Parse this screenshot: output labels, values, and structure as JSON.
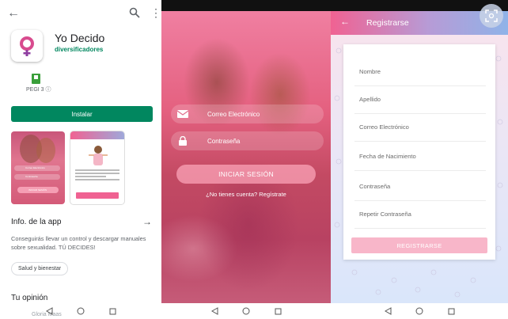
{
  "store": {
    "app_title": "Yo Decido",
    "developer": "diversificadores",
    "rating_label": "PEGI 3",
    "install_label": "Instalar",
    "screenshot1_lines": [
      "Correo Electrónico",
      "Contraseña",
      "INICIAR SESIÓN"
    ],
    "screenshot2_header": "Inicio",
    "screenshot2_button": "VER",
    "info_title": "Info. de la app",
    "description": "Conseguirás llevar un control y descargar manuales sobre sexualidad. TÚ DECIDES!",
    "category_chip": "Salud y bienestar",
    "opinion_title": "Tu opinión",
    "cut_text": "Gloria Maas"
  },
  "login": {
    "email_label": "Correo Electrónico",
    "password_label": "Contraseña",
    "login_button": "INICIAR SESIÓN",
    "register_link": "¿No tienes cuenta? Regístrate"
  },
  "register": {
    "title": "Registrarse",
    "fields": [
      "Nombre",
      "Apellido",
      "Correo Electrónico",
      "Fecha de Nacimiento",
      "Contraseña",
      "Repetir Contraseña"
    ],
    "register_button": "REGISTRARSE"
  },
  "colors": {
    "install_green": "#01875f",
    "pink": "#f06292",
    "blue": "#8fb3e8"
  }
}
